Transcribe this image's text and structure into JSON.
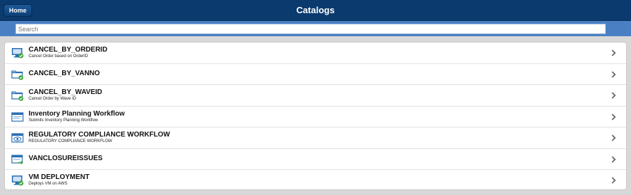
{
  "header": {
    "home_label": "Home",
    "title": "Catalogs"
  },
  "search": {
    "placeholder": "Search",
    "value": ""
  },
  "catalog_items": [
    {
      "title": "CANCEL_BY_ORDERID",
      "subtitle": "Cancel Order based on OrderID",
      "icon": "monitor-check-icon"
    },
    {
      "title": "CANCEL_BY_VANNO",
      "subtitle": "",
      "icon": "folder-check-icon"
    },
    {
      "title": "CANCEL_BY_WAVEID",
      "subtitle": "Cancel Order by Wave ID",
      "icon": "folder-check-icon"
    },
    {
      "title": "Inventory Planning Workflow",
      "subtitle": "Submits Inventory Planning Workflow",
      "icon": "window-icon"
    },
    {
      "title": "REGULATORY COMPLIANCE WORKFLOW",
      "subtitle": "REGULATORY COMPLIANCE WORKFLOW",
      "icon": "eye-window-icon"
    },
    {
      "title": "VANCLOSUREISSUES",
      "subtitle": "",
      "icon": "window-arrow-icon"
    },
    {
      "title": "VM DEPLOYMENT",
      "subtitle": "Deploys VM on AWS",
      "icon": "monitor-check-icon"
    }
  ],
  "colors": {
    "header_bg": "#0a3a6e",
    "search_bar_bg": "#4a7fc4",
    "icon_blue": "#2a6fb5",
    "icon_green": "#3aa63a"
  }
}
